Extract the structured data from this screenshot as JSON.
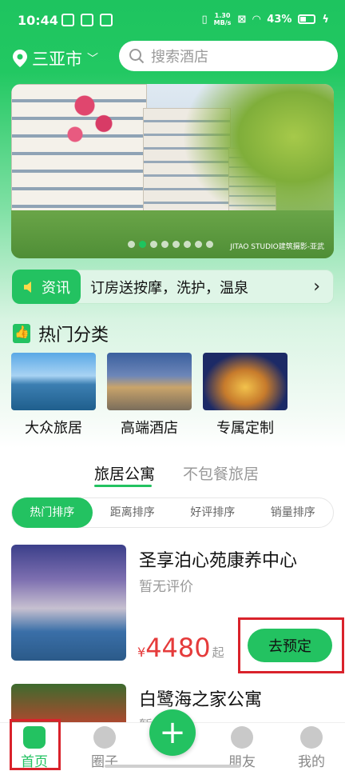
{
  "status_bar": {
    "time": "10:44",
    "net_speed_top": "1.30",
    "net_speed_bottom": "MB/s",
    "battery": "43%"
  },
  "header": {
    "city": "三亚市",
    "search_placeholder": "搜索酒店"
  },
  "banner": {
    "watermark": "JITAO STUDIO建筑摄影-亚武",
    "slides": 8,
    "active_slide": 2
  },
  "news": {
    "tag": "资讯",
    "text": "订房送按摩，洗护，温泉"
  },
  "hot_categories": {
    "title": "热门分类",
    "items": [
      {
        "label": "大众旅居"
      },
      {
        "label": "高端酒店"
      },
      {
        "label": "专属定制"
      }
    ]
  },
  "tabs": [
    {
      "label": "旅居公寓",
      "active": true
    },
    {
      "label": "不包餐旅居",
      "active": false
    }
  ],
  "sort": [
    {
      "label": "热门排序",
      "active": true
    },
    {
      "label": "距离排序"
    },
    {
      "label": "好评排序"
    },
    {
      "label": "销量排序"
    }
  ],
  "hotels": [
    {
      "name": "圣享泊心苑康养中心",
      "rating": "暂无评价",
      "currency": "¥",
      "price": "4480",
      "price_suffix": "起",
      "book_label": "去预定"
    },
    {
      "name": "白鹭海之家公寓",
      "rating": "暂无评价"
    }
  ],
  "nav": [
    {
      "label": "首页",
      "active": true
    },
    {
      "label": "圈子"
    },
    {
      "label": "+"
    },
    {
      "label": "朋友"
    },
    {
      "label": "我的"
    }
  ],
  "colors": {
    "brand": "#23c261",
    "price": "#e53b3b",
    "highlight": "#d9222b"
  }
}
